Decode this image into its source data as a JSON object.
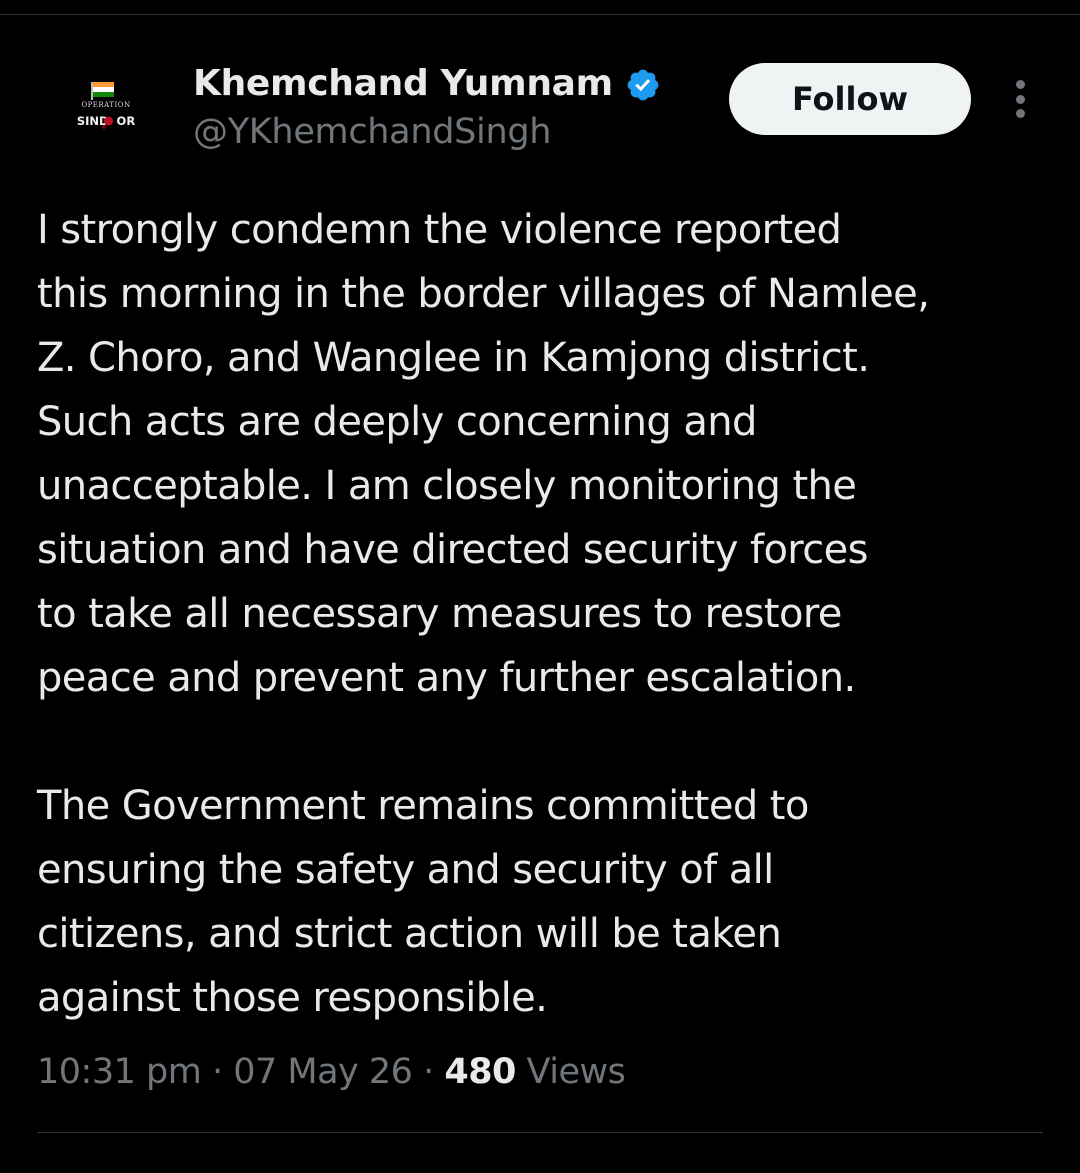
{
  "author": {
    "display_name": "Khemchand Yumnam",
    "handle": "@YKhemchandSingh",
    "avatar": {
      "icon": "operation-sindoor-logo",
      "line1": "OPERATION",
      "line2": "SIND  OR"
    },
    "verified_icon": "verified-badge-icon",
    "verified_color": "#1d9bf0"
  },
  "actions": {
    "follow_label": "Follow",
    "more_icon": "more-vertical-icon"
  },
  "tweet": {
    "paragraphs": [
      "I strongly condemn the violence reported\nthis morning in the border villages of Namlee,\nZ. Choro, and Wanglee in Kamjong district.\nSuch acts are deeply concerning and\nunacceptable. I am closely monitoring the\nsituation and have directed security forces\nto take all necessary measures to restore\npeace and prevent any further escalation.",
      "The Government remains committed to\nensuring the safety and security of all\ncitizens, and strict action will be taken\nagainst those responsible."
    ]
  },
  "meta": {
    "time": "10:31 pm",
    "separator": "·",
    "date": "07 May 26",
    "views_count": "480",
    "views_label": "Views"
  },
  "colors": {
    "background": "#000000",
    "text_primary": "#e7e9ea",
    "text_secondary": "#71767b",
    "follow_bg": "#eff3f4",
    "divider": "#2f3336"
  }
}
